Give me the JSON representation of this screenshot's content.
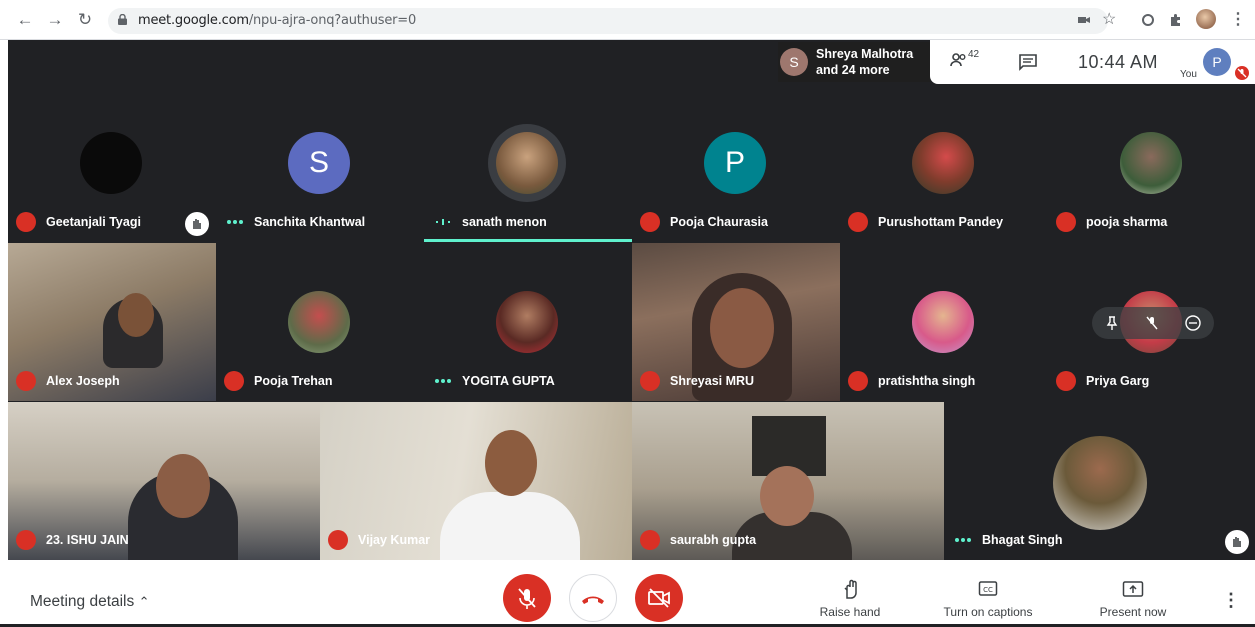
{
  "browser": {
    "url_domain": "meet.google.com",
    "url_path": "/npu-ajra-onq?authuser=0"
  },
  "topbar": {
    "presenter_initial": "S",
    "presenter_name": "Shreya Malhotra",
    "presenter_more": "and 24 more",
    "participant_count": "42",
    "time": "10:44 AM",
    "you_label": "You",
    "you_initial": "P"
  },
  "tiles": [
    {
      "name": "Geetanjali Tyagi",
      "muted": true
    },
    {
      "name": "Sanchita Khantwal",
      "muted": false,
      "initial": "S",
      "color": "#5c6bc0"
    },
    {
      "name": "sanath menon",
      "muted": false
    },
    {
      "name": "Pooja Chaurasia",
      "muted": true,
      "initial": "P",
      "color": "#00838f"
    },
    {
      "name": "Purushottam Pandey",
      "muted": true
    },
    {
      "name": "pooja sharma",
      "muted": true
    },
    {
      "name": "Alex Joseph",
      "muted": true
    },
    {
      "name": "Pooja Trehan",
      "muted": true
    },
    {
      "name": "YOGITA GUPTA",
      "muted": false
    },
    {
      "name": "Shreyasi MRU",
      "muted": true
    },
    {
      "name": "pratishtha singh",
      "muted": true
    },
    {
      "name": "Priya Garg",
      "muted": true
    },
    {
      "name": "23. ISHU JAIN",
      "muted": true
    },
    {
      "name": "Vijay Kumar",
      "muted": true
    },
    {
      "name": "saurabh gupta",
      "muted": true
    },
    {
      "name": "Bhagat Singh",
      "muted": false
    }
  ],
  "bottombar": {
    "meeting_details": "Meeting details",
    "raise_hand": "Raise hand",
    "captions": "Turn on captions",
    "present": "Present now"
  },
  "colors": {
    "mute_red": "#d93025",
    "speaking_teal": "#5ff1cd",
    "background": "#202124"
  }
}
